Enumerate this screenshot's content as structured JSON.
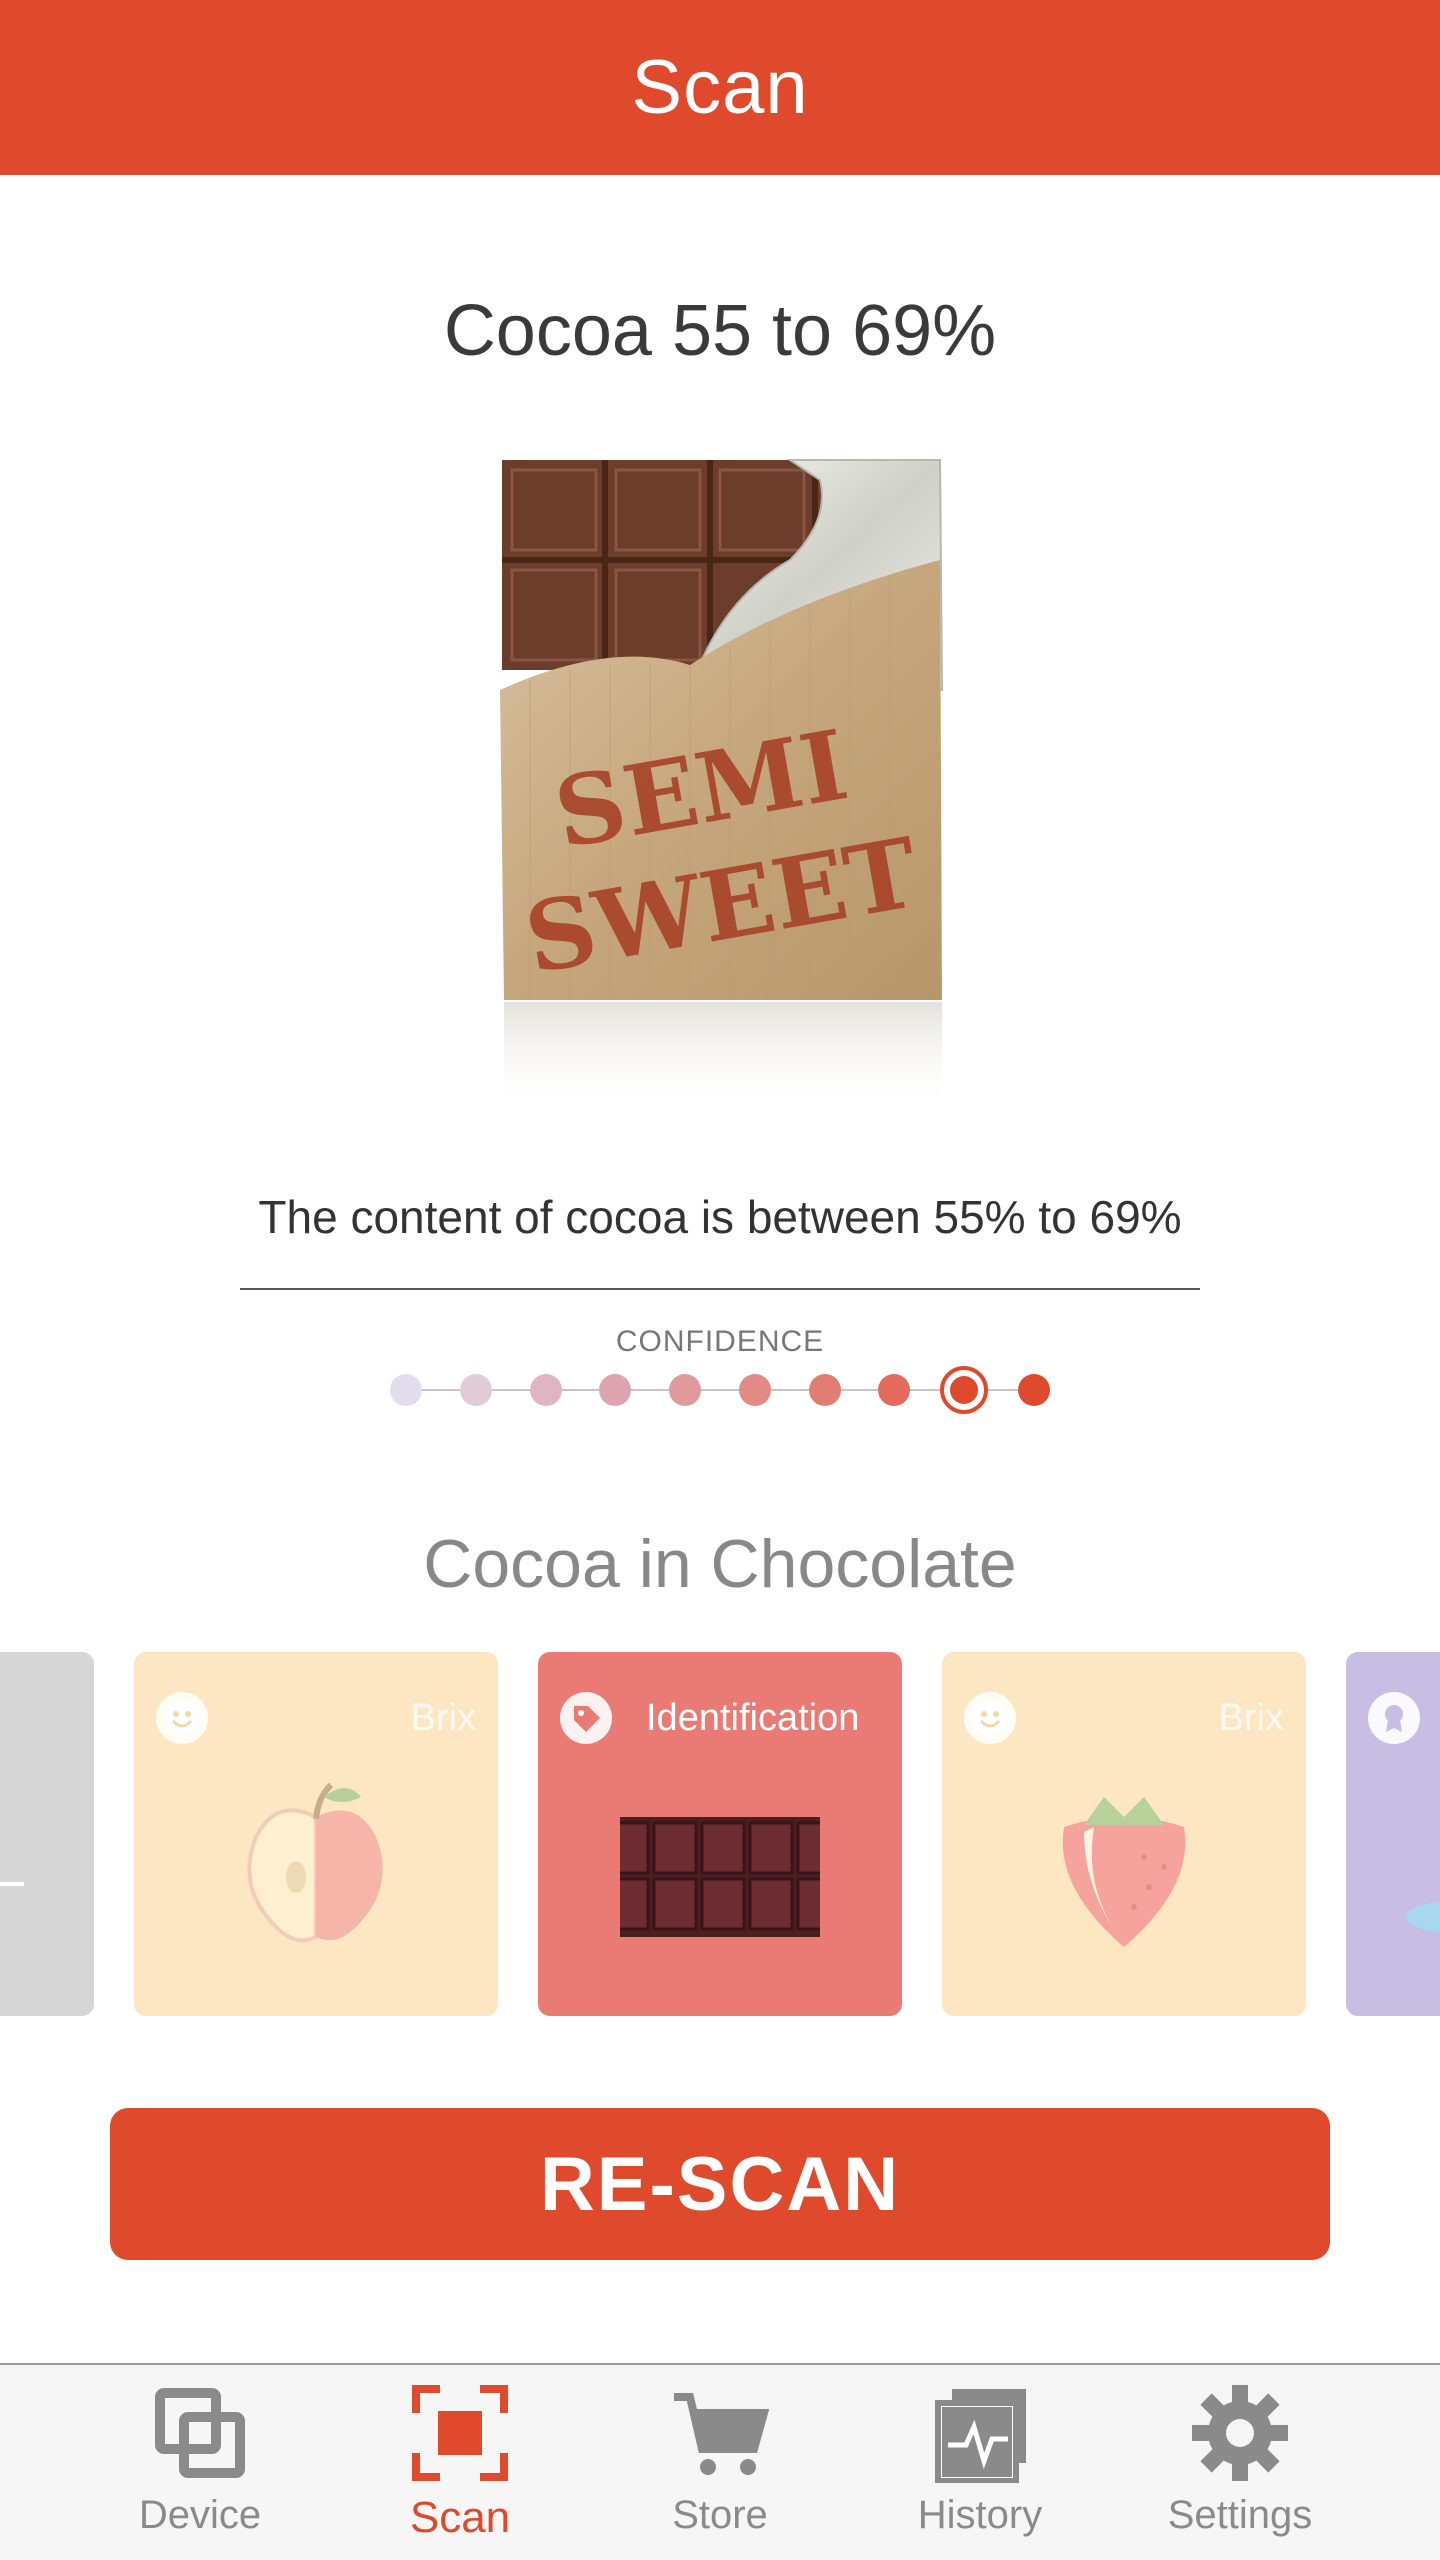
{
  "app_bar": {
    "title": "Scan"
  },
  "result": {
    "title": "Cocoa 55 to 69%",
    "image_label": "SEMI SWEET",
    "description": "The content of cocoa is between 55% to 69%"
  },
  "confidence": {
    "label": "CONFIDENCE",
    "levels": 10,
    "selected_level": 9,
    "dot_colors": [
      "#e3dcec",
      "#e2cad8",
      "#dfb5c3",
      "#dea4b0",
      "#e09a9b",
      "#e28b85",
      "#e27d71",
      "#e26b5b",
      "#e04a2c",
      "#e04a2c"
    ]
  },
  "section": {
    "title": "Cocoa in Chocolate"
  },
  "cards": [
    {
      "label": "",
      "icon": "dash-icon",
      "color": "#d6d6d6",
      "faded": false
    },
    {
      "label": "Brix",
      "icon": "smiley-icon",
      "art": "apple-icon",
      "color": "#fde7c3",
      "faded": true
    },
    {
      "label": "Identification",
      "icon": "tag-icon",
      "art": "chocolate-bar-icon",
      "color": "#ea7b74",
      "faded": false
    },
    {
      "label": "Brix",
      "icon": "smiley-icon",
      "art": "strawberry-icon",
      "color": "#fde7c3",
      "faded": true
    },
    {
      "label": "",
      "icon": "award-icon",
      "color": "#c8bde3",
      "faded": false
    }
  ],
  "actions": {
    "rescan_label": "RE-SCAN"
  },
  "nav": {
    "items": [
      {
        "label": "Device",
        "icon": "device-icon"
      },
      {
        "label": "Scan",
        "icon": "scan-icon"
      },
      {
        "label": "Store",
        "icon": "cart-icon"
      },
      {
        "label": "History",
        "icon": "history-icon"
      },
      {
        "label": "Settings",
        "icon": "gear-icon"
      }
    ],
    "active": "Scan"
  },
  "colors": {
    "accent": "#e04a2c",
    "inactive": "#8a8a8a"
  }
}
